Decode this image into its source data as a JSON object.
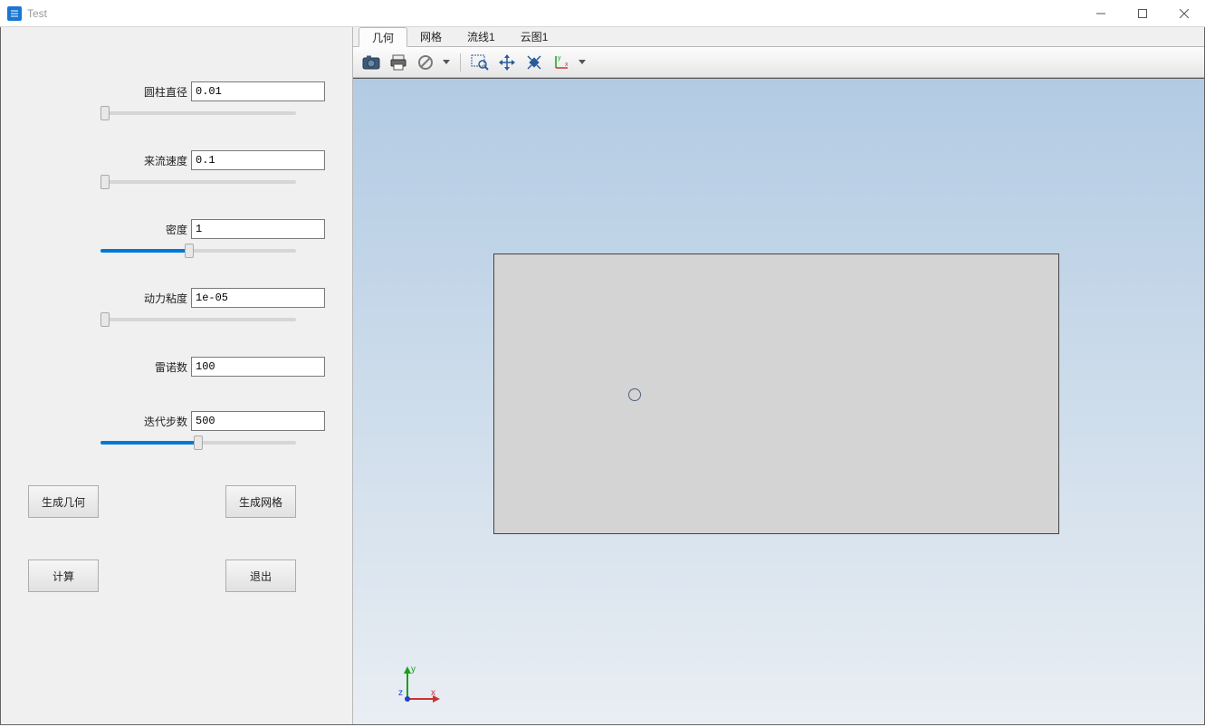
{
  "window": {
    "title": "Test"
  },
  "params": {
    "cylinder_diameter": {
      "label": "圆柱直径",
      "value": "0.01",
      "slider": 0
    },
    "inflow_velocity": {
      "label": "来流速度",
      "value": "0.1",
      "slider": 0
    },
    "density": {
      "label": "密度",
      "value": "1",
      "slider": 45
    },
    "dynamic_viscosity": {
      "label": "动力粘度",
      "value": "1e-05",
      "slider": 0
    },
    "reynolds_number": {
      "label": "雷诺数",
      "value": "100"
    },
    "iteration_steps": {
      "label": "迭代步数",
      "value": "500",
      "slider": 50
    }
  },
  "buttons": {
    "gen_geometry": "生成几何",
    "gen_mesh": "生成网格",
    "compute": "计算",
    "exit": "退出"
  },
  "tabs": {
    "geometry": "几何",
    "mesh": "网格",
    "stream1": "流线1",
    "contour1": "云图1"
  },
  "toolbar": {
    "camera": "camera-icon",
    "print": "print-icon",
    "forbid": "forbid-icon",
    "zoom_box": "zoom-box-icon",
    "pan": "pan-icon",
    "fit": "fit-icon",
    "axis": "axis-icon"
  },
  "axis_labels": {
    "x": "x",
    "y": "y",
    "z": "z"
  }
}
